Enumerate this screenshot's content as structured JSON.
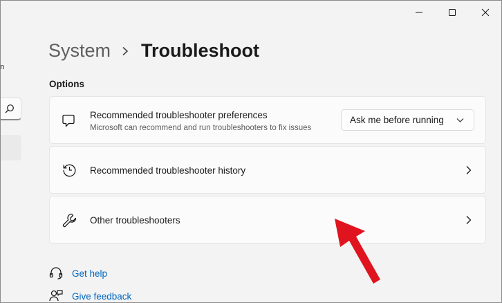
{
  "window": {
    "minimize_icon": "minimize-icon",
    "maximize_icon": "maximize-icon",
    "close_icon": "close-icon"
  },
  "nav": {
    "fragment_text": "n",
    "search_icon": "search-icon"
  },
  "header": {
    "parent": "System",
    "separator_icon": "chevron-right-icon",
    "current": "Troubleshoot"
  },
  "options": {
    "label": "Options",
    "cards": [
      {
        "icon": "chat-bubble-icon",
        "title": "Recommended troubleshooter preferences",
        "description": "Microsoft can recommend and run troubleshooters to fix issues",
        "dropdown_value": "Ask me before running"
      },
      {
        "icon": "history-icon",
        "title": "Recommended troubleshooter history"
      },
      {
        "icon": "wrench-icon",
        "title": "Other troubleshooters"
      }
    ]
  },
  "links": {
    "help": "Get help",
    "feedback": "Give feedback"
  },
  "annotation": {
    "arrow_color": "#e0141e"
  },
  "colors": {
    "background": "#f3f3f3",
    "card": "#fbfbfb",
    "link": "#0067c0"
  }
}
